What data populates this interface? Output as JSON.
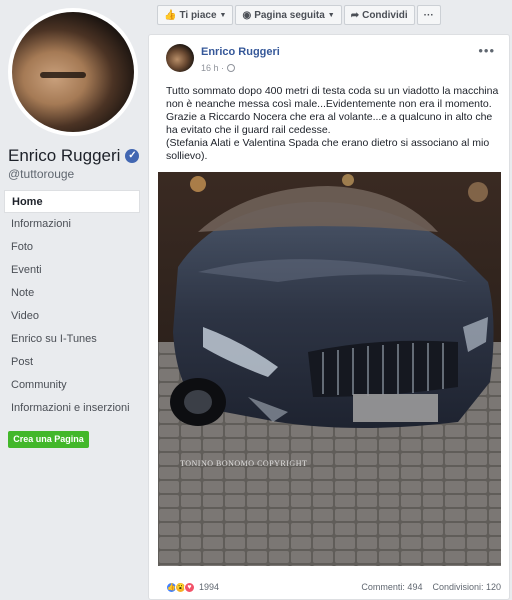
{
  "sidebar": {
    "page_name": "Enrico Ruggeri",
    "verified_mark": "✓",
    "handle": "@tuttorouge",
    "nav": [
      "Home",
      "Informazioni",
      "Foto",
      "Eventi",
      "Note",
      "Video",
      "Enrico su I-Tunes",
      "Post",
      "Community",
      "Informazioni e inserzioni"
    ],
    "create_page_label": "Crea una Pagina"
  },
  "topbar": {
    "like_label": "Ti piace",
    "follow_label": "Pagina seguita",
    "share_label": "Condividi",
    "more_label": "···"
  },
  "post": {
    "author": "Enrico Ruggeri",
    "time": "16 h ·",
    "more_label": "•••",
    "text": "Tutto sommato dopo 400 metri di testa coda su un viadotto la macchina non è neanche messa così male...Evidentemente non era il momento.\nGrazie a Riccardo Nocera che era al volante...e a qualcuno in alto che ha evitato che il guard rail cedesse.\n(Stefania Alati e Valentina Spada che erano dietro si associano al mio sollievo).",
    "photo_watermark": "TONINO BONOMO COPYRIGHT",
    "reactions_count": "1994",
    "comments": "Commenti: 494",
    "shares": "Condivisioni: 120"
  },
  "colors": {
    "link_blue": "#365899",
    "verified_blue": "#4267b2",
    "create_green": "#42b72a",
    "page_bg": "#e9ebee"
  },
  "icons": {
    "like": "thumbs-up-icon",
    "follow": "rss-icon",
    "share": "share-arrow-icon",
    "privacy": "globe-icon"
  }
}
